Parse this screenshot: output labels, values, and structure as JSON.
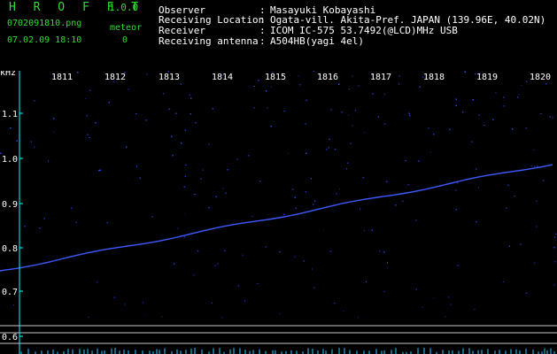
{
  "app": {
    "name": "H R O F F T",
    "version": "1.0.0"
  },
  "file": {
    "name": "0702091810.png",
    "datetime": "07.02.09 18:10"
  },
  "meteor": {
    "label": "meteor",
    "count": "0"
  },
  "info": [
    {
      "label": "Observer",
      "value": "Masayuki Kobayashi"
    },
    {
      "label": "Receiving Location",
      "value": "Ogata-vill. Akita-Pref. JAPAN (139.96E, 40.02N)"
    },
    {
      "label": "Receiver",
      "value": "ICOM IC-575 53.7492(@LCD)MHz USB"
    },
    {
      "label": "Receiving antenna",
      "value": "A504HB(yagi 4el)"
    }
  ],
  "colon": ":",
  "spectrogram": {
    "unit_label": "kHz",
    "time_ticks": [
      "1811",
      "1812",
      "1813",
      "1814",
      "1815",
      "1816",
      "1817",
      "1818",
      "1819",
      "1820"
    ],
    "freq_ticks": [
      "1.1",
      "1.0",
      "0.9",
      "0.8",
      "0.7",
      "0.6"
    ],
    "colors": {
      "background": "#000000",
      "noise": "#1e32c8",
      "trace": "#3c5aff",
      "grid": "#c8c8c8",
      "axis": "#00ffff",
      "label": "#33dd33"
    }
  }
}
